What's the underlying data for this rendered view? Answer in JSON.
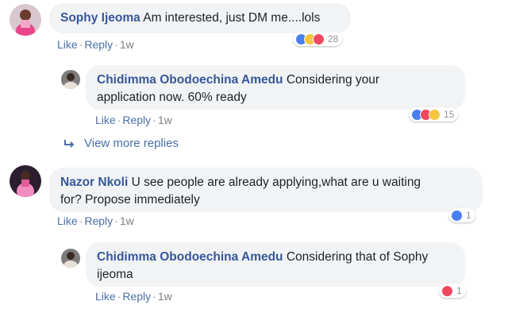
{
  "comments": [
    {
      "author": "Sophy Ijeoma",
      "text": "Am interested, just DM me....lols",
      "like": "Like",
      "reply": "Reply",
      "time": "1w",
      "reaction_count": "28",
      "reaction_icons": [
        "like-icon",
        "wow-icon",
        "love-icon"
      ]
    },
    {
      "author": "Chidimma Obodoechina Amedu",
      "text_line1": "Considering your",
      "text_line2": "application now. 60% ready",
      "like": "Like",
      "reply": "Reply",
      "time": "1w",
      "reaction_count": "15",
      "reaction_icons": [
        "like-icon",
        "love-icon",
        "wow-icon"
      ]
    },
    {
      "author": "Nazor Nkoli",
      "text_line1": "U see people are already applying,what are u waiting",
      "text_line2": "for? Propose immediately",
      "like": "Like",
      "reply": "Reply",
      "time": "1w",
      "reaction_count": "1",
      "reaction_icons": [
        "like-icon"
      ]
    },
    {
      "author": "Chidimma Obodoechina Amedu",
      "text_line1": "Considering that of Sophy",
      "text_line2": "ijeoma",
      "like": "Like",
      "reply": "Reply",
      "time": "1w",
      "reaction_count": "1",
      "reaction_icons": [
        "love-icon"
      ]
    }
  ],
  "view_more": "View more replies",
  "colors": {
    "name": "#365899",
    "link": "#4b6fa8",
    "bubble": "#f2f3f5",
    "like": "#4a7ef2",
    "love": "#f0485e",
    "wow": "#f7c53c"
  }
}
